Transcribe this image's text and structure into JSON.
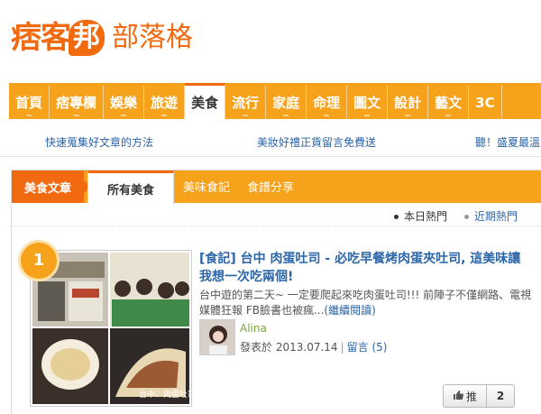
{
  "logo": {
    "main": "痞客",
    "mark": "邦",
    "sub": "部落格"
  },
  "nav": {
    "items": [
      {
        "label": "首頁"
      },
      {
        "label": "痞專欄"
      },
      {
        "label": "娛樂"
      },
      {
        "label": "旅遊"
      },
      {
        "label": "美食"
      },
      {
        "label": "流行"
      },
      {
        "label": "家庭"
      },
      {
        "label": "命理"
      },
      {
        "label": "圖文"
      },
      {
        "label": "設計"
      },
      {
        "label": "藝文"
      },
      {
        "label": "3C"
      }
    ],
    "active_index": 4
  },
  "sublinks": [
    "快速蒐集好文章的方法",
    "美妝好禮正貨留言免費送",
    "聽！盛夏最溫"
  ],
  "section": {
    "category_tab": "美食文章",
    "tabs": [
      "所有美食",
      "美味食記",
      "食譜分享"
    ]
  },
  "hot": {
    "today": "本日熱門",
    "recent": "近期熱門"
  },
  "article": {
    "rank": "1",
    "title": "[食記] 台中 肉蛋吐司 - 必吃早餐烤肉蛋夾吐司, 這美味讓我想一次吃兩個!",
    "excerpt": "台中遊的第二天~ 一定要爬起來吃肉蛋吐司!!! 前陣子不僅網路、電視媒體狂報 FB臉書也被瘋...",
    "read_more": "(繼續閱讀)",
    "author": "Alina",
    "posted_prefix": "發表於",
    "date": "2013.07.14",
    "comments_label": "留言",
    "comments_count": "(5)",
    "push_label": "推",
    "push_count": "2",
    "thumb_caption": "台中．肉蛋吐司"
  },
  "colors": {
    "accent": "#f26a10",
    "nav_bg": "#f7a21b",
    "link": "#2a65a8"
  }
}
